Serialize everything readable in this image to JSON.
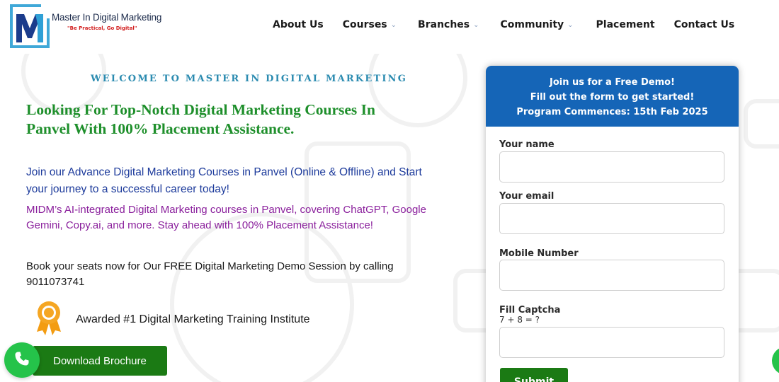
{
  "brand": {
    "title": "Master In Digital Marketing",
    "tagline": "\"Be Practical, Go Digital\"",
    "logo_letter": "M"
  },
  "nav": {
    "items": [
      {
        "label": "About Us",
        "dropdown": false
      },
      {
        "label": "Courses",
        "dropdown": true
      },
      {
        "label": "Branches",
        "dropdown": true
      },
      {
        "label": "Community",
        "dropdown": true
      },
      {
        "label": "Placement",
        "dropdown": false
      },
      {
        "label": "Contact Us",
        "dropdown": false
      }
    ],
    "chevron": "⌵"
  },
  "hero": {
    "welcome": "WELCOME TO MASTER IN DIGITAL MARKETING",
    "headline": "Looking For Top-Notch Digital Marketing Courses In Panvel With 100% Placement Assistance.",
    "intro": "Join our Advance Digital Marketing Courses in Panvel (Online & Offline) and Start your journey to a successful career today!",
    "ai_text": "MIDM’s AI-integrated Digital Marketing courses in Panvel, covering ChatGPT, Google Gemini, Copy.ai, and more. Stay ahead with 100% Placement Assistance!",
    "book_text": "Book your seats now for Our FREE Digital Marketing Demo Session by calling 9011073741",
    "award": "Awarded #1 Digital Marketing Training Institute",
    "brochure_button": "Download Brochure"
  },
  "form": {
    "heading_line1": "Join us for a Free Demo!",
    "heading_line2": "Fill out the form to get started!",
    "heading_line3": "Program Commences: 15th Feb 2025",
    "name_label": "Your name",
    "name_value": "",
    "email_label": "Your email",
    "email_value": "",
    "mobile_label": "Mobile Number",
    "mobile_value": "",
    "captcha_label": "Fill Captcha",
    "captcha_question": "7 + 8 = ?",
    "captcha_value": "",
    "submit_label": "Submit"
  },
  "colors": {
    "form_header": "#1565b7",
    "headline": "#1e8f2b",
    "intro": "#1c3a9b",
    "ai_text": "#8a1f9c",
    "button_green": "#1b7a14",
    "whatsapp_green": "#25c34a"
  },
  "icons": [
    "logo-icon",
    "chevron-down-icon",
    "award-medal-icon",
    "phone-icon"
  ]
}
